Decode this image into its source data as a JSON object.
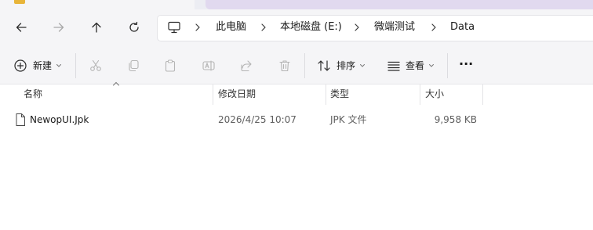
{
  "tabbar": {
    "active_tab_color": "#f5f5f7",
    "other_tab_color": "#e1d9ef"
  },
  "navigation": {
    "back_icon": "arrow-left-icon",
    "forward_icon": "arrow-right-icon",
    "up_icon": "arrow-up-icon",
    "refresh_icon": "refresh-icon"
  },
  "breadcrumb": {
    "root_icon": "computer-icon",
    "items": [
      "此电脑",
      "本地磁盘 (E:)",
      "微端测试",
      "Data"
    ]
  },
  "toolbar": {
    "new_label": "新建",
    "sort_label": "排序",
    "view_label": "查看",
    "more_label": "···"
  },
  "columns": {
    "name": "名称",
    "modified": "修改日期",
    "type": "类型",
    "size": "大小"
  },
  "files": [
    {
      "name": "NewopUI.Jpk",
      "modified": "2026/4/25 10:07",
      "type": "JPK 文件",
      "size": "9,958 KB",
      "icon": "file-icon"
    }
  ]
}
